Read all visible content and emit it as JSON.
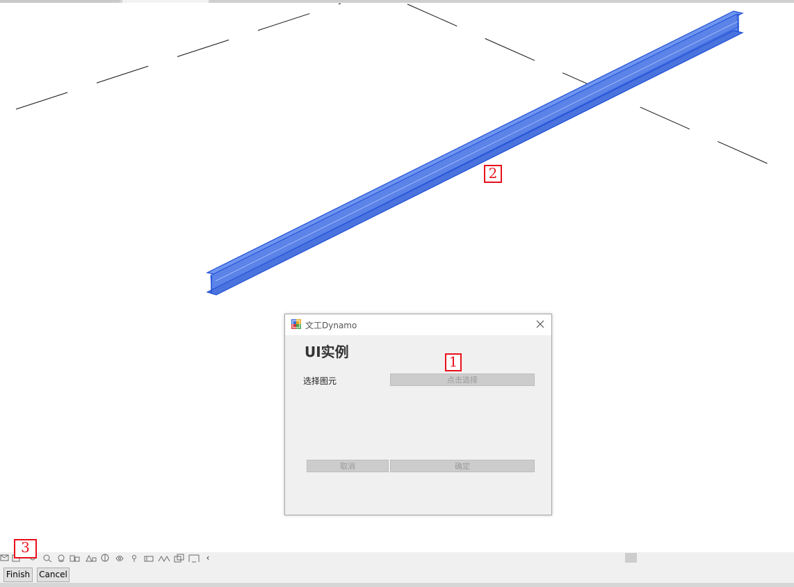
{
  "dialog": {
    "title": "文工Dynamo",
    "heading": "UI实例",
    "select_label": "选择图元",
    "pick_button": "点击选择",
    "cancel_button": "取消",
    "ok_button": "确定"
  },
  "callouts": [
    "1",
    "2",
    "3"
  ],
  "bottom_bar": {
    "finish_label": "Finish",
    "cancel_label": "Cancel",
    "scroll_left_glyph": "‹"
  },
  "icons": {
    "dialog_app": "app-window-icon",
    "dialog_close": "close-icon",
    "options": [
      "tool-icon-1",
      "tool-icon-2",
      "tool-icon-3",
      "tool-icon-4",
      "tool-icon-5",
      "tool-icon-6",
      "tool-icon-7",
      "tool-icon-8",
      "tool-icon-9",
      "tool-icon-10",
      "tool-icon-11",
      "tool-icon-12",
      "tool-icon-13",
      "tool-icon-14"
    ]
  },
  "colors": {
    "beam_fill": "#5b83e8",
    "beam_edge": "#1f4fd6",
    "callout_red": "#e8101b",
    "dialog_bg": "#f0f0f0",
    "disabled_button": "#cccccc"
  }
}
